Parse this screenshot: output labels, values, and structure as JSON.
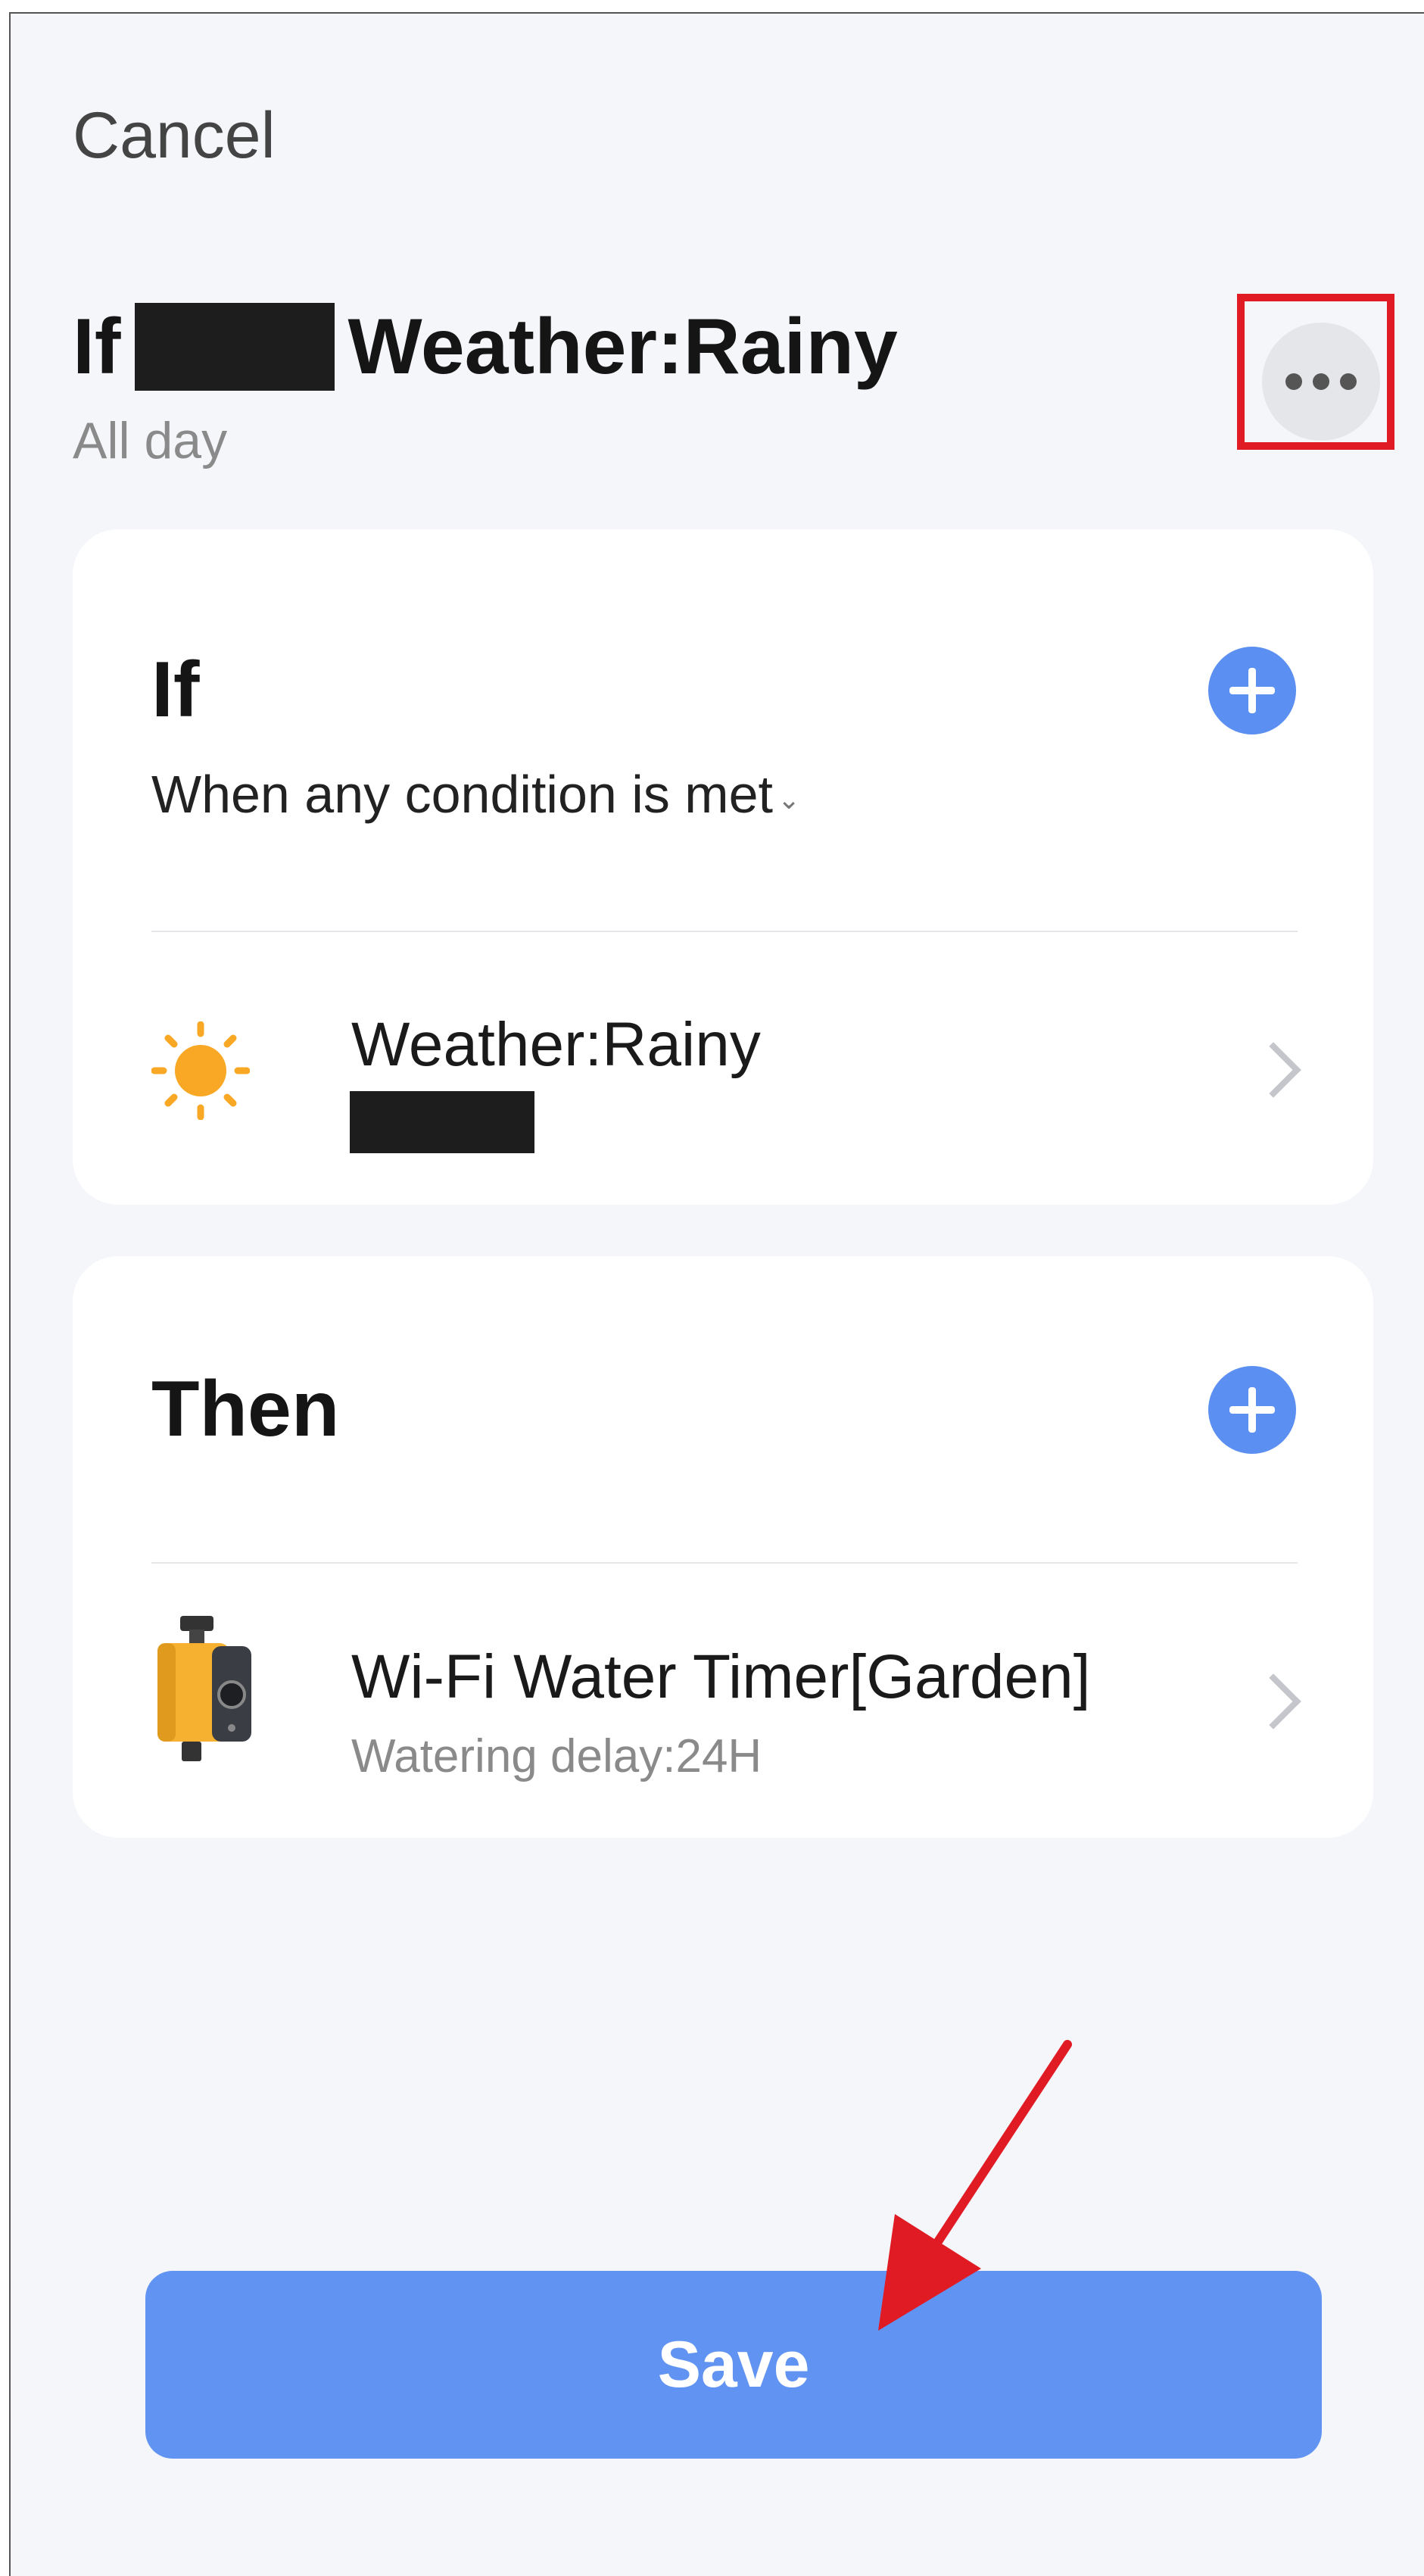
{
  "header": {
    "cancel_label": "Cancel",
    "title_prefix": "If",
    "title_suffix": "Weather:Rainy",
    "subtitle": "All day",
    "more_icon": "more-horizontal-icon"
  },
  "if_section": {
    "heading": "If",
    "condition_mode": "When any condition is met",
    "add_icon": "plus-icon",
    "items": [
      {
        "title": "Weather:Rainy",
        "icon": "sun-icon"
      }
    ]
  },
  "then_section": {
    "heading": "Then",
    "add_icon": "plus-icon",
    "items": [
      {
        "title": "Wi-Fi Water Timer[Garden]",
        "subtitle": "Watering delay:24H",
        "icon": "water-timer-icon"
      }
    ]
  },
  "footer": {
    "save_label": "Save"
  },
  "colors": {
    "accent": "#5b8ff2",
    "save_button": "#6193f2",
    "background": "#f4f6fa",
    "highlight": "#e01b24",
    "annotation_arrow": "#e01b24"
  }
}
